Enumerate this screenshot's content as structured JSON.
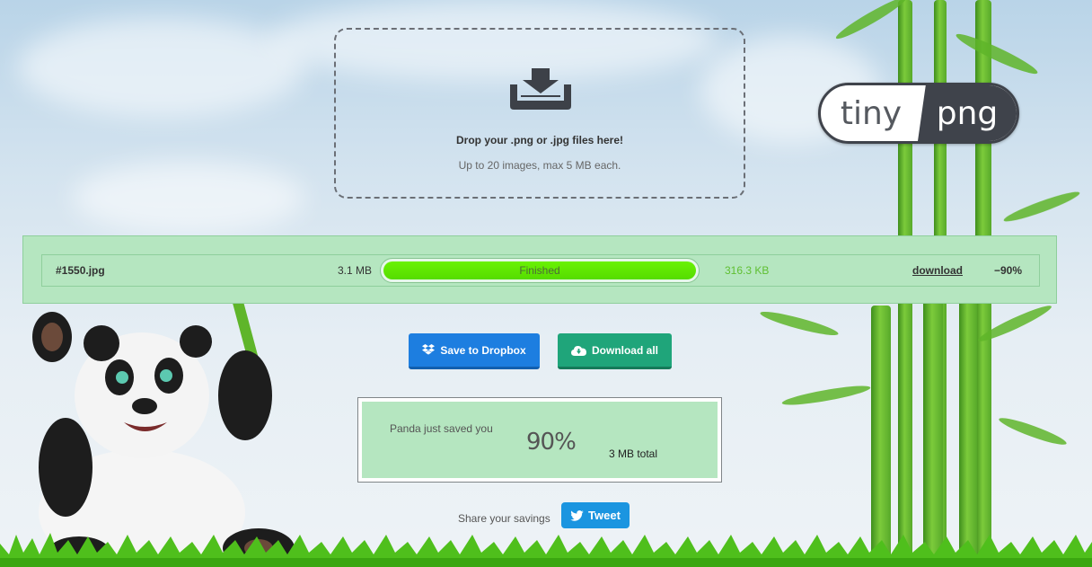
{
  "logo": {
    "left": "tiny",
    "right": "png"
  },
  "dropzone": {
    "icon": "download-tray-icon",
    "title": "Drop your .png or .jpg files here!",
    "subtitle": "Up to 20 images, max 5 MB each."
  },
  "files": [
    {
      "name": "#1550.jpg",
      "original_size": "3.1 MB",
      "status": "Finished",
      "progress": 1.0,
      "compressed_size": "316.3 KB",
      "download_label": "download",
      "savings_percent": "−90%"
    }
  ],
  "actions": {
    "dropbox_label": "Save to Dropbox",
    "dropbox_icon": "dropbox-icon",
    "download_all_label": "Download all",
    "download_all_icon": "cloud-download-icon"
  },
  "savings": {
    "label": "Panda just saved you",
    "percent": "90%",
    "total": "3 MB total"
  },
  "share": {
    "label": "Share your savings",
    "tweet_label": "Tweet",
    "tweet_icon": "twitter-bird-icon"
  },
  "colors": {
    "panel_green": "#b5e6c0",
    "progress_green": "#5fe400",
    "dropbox_blue": "#1d7ee0",
    "download_green": "#1fa57a",
    "twitter_blue": "#1b95e0",
    "logo_dark": "#3f434b"
  }
}
